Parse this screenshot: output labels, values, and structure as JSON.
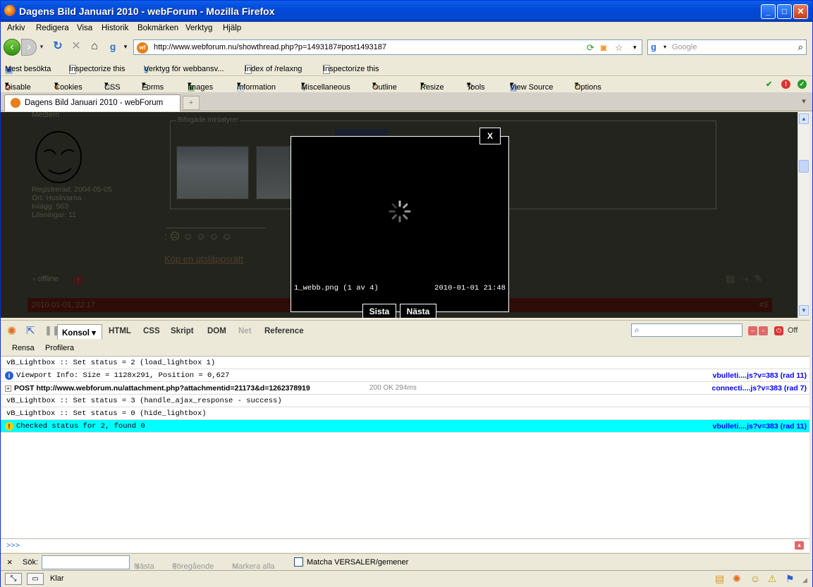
{
  "window": {
    "title": "Dagens Bild Januari 2010 - webForum - Mozilla Firefox"
  },
  "menu": [
    "Arkiv",
    "Redigera",
    "Visa",
    "Historik",
    "Bokmärken",
    "Verktyg",
    "Hjälp"
  ],
  "nav": {
    "url": "http://www.webforum.nu/showthread.php?p=1493187#post1493187",
    "search_placeholder": "Google"
  },
  "bookmarks": [
    "Mest besökta",
    "Inspectorize this",
    "Verktyg för webbansv...",
    "Index of /relaxng",
    "Inspectorize this"
  ],
  "devtoolbar": [
    "Disable",
    "Cookies",
    "CSS",
    "Forms",
    "Images",
    "Information",
    "Miscellaneous",
    "Outline",
    "Resize",
    "Tools",
    "View Source",
    "Options"
  ],
  "tab": {
    "label": "Dagens Bild Januari 2010 - webForum"
  },
  "page": {
    "member": "Medlem",
    "registered": "Registrerad: 2004-05-05",
    "location": "Ort: Huskvarna",
    "posts": "Inlägg: 563",
    "solutions": "Lösningar: 11",
    "attachments_legend": "Bifogade miniatyrer",
    "signature_link": "Köp en utsläppsrätt",
    "offline": "offline",
    "post_date": "2010-01-01, 22:17",
    "post_number": "#3"
  },
  "lightbox": {
    "close": "X",
    "filename": "1_webb.png (1 av 4)",
    "timestamp": "2010-01-01 21:48",
    "last_button": "Sista",
    "next_button": "Nästa"
  },
  "firebug": {
    "tabs": [
      "Konsol ▾",
      "HTML",
      "CSS",
      "Skript",
      "DOM",
      "Net",
      "Reference"
    ],
    "off_label": "Off",
    "sub": [
      "Rensa",
      "Profilera"
    ],
    "rows": [
      {
        "text": "vB_Lightbox :: Set status = 2 (load_lightbox 1)",
        "source": ""
      },
      {
        "text": "Viewport Info: Size = 1128x291, Position = 0,627",
        "source": "vbulleti....js?v=383 (rad 11)"
      },
      {
        "text": "POST http://www.webforum.nu/attachment.php?attachmentid=21173&d=1262378919",
        "status": "200 OK 294ms",
        "source": "connecti....js?v=383 (rad 7)"
      },
      {
        "text": "vB_Lightbox :: Set status = 3 (handle_ajax_response - success)",
        "source": ""
      },
      {
        "text": "vB_Lightbox :: Set status = 0 (hide_lightbox)",
        "source": ""
      },
      {
        "text": "Checked status for 2, found 0",
        "source": "vbulleti....js?v=383 (rad 11)"
      }
    ],
    "prompt": ">>>"
  },
  "findbar": {
    "close": "×",
    "label": "Sök:",
    "next": "Nästa",
    "prev": "Föregående",
    "highlight": "Markera alla",
    "match_case": "Matcha VERSALER/gemener"
  },
  "status": {
    "text": "Klar"
  },
  "colors": {
    "titlebar": "#0349d8",
    "warning_row": "#00ffff",
    "link": "#0000ff"
  }
}
